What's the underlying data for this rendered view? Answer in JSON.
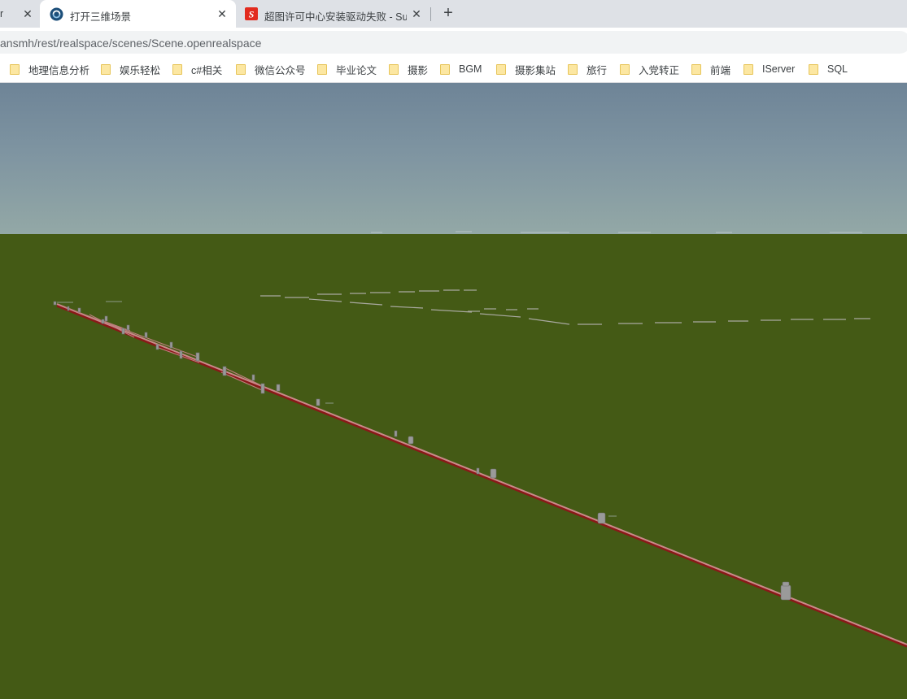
{
  "tabs": [
    {
      "title": "r",
      "active": false
    },
    {
      "title": "打开三维场景",
      "active": true
    },
    {
      "title": "超图许可中心安装驱动失败 - Sup",
      "active": false
    }
  ],
  "new_tab_label": "+",
  "address_bar": {
    "url": "ansmh/rest/realspace/scenes/Scene.openrealspace"
  },
  "bookmarks": [
    {
      "label": "地理信息分析"
    },
    {
      "label": "娱乐轻松"
    },
    {
      "label": "c#相关"
    },
    {
      "label": "微信公众号"
    },
    {
      "label": "毕业论文"
    },
    {
      "label": "摄影"
    },
    {
      "label": "BGM"
    },
    {
      "label": "摄影集站"
    },
    {
      "label": "旅行"
    },
    {
      "label": "入党转正"
    },
    {
      "label": "前端"
    },
    {
      "label": "IServer"
    },
    {
      "label": "SQL"
    }
  ],
  "scene": {
    "sky_color": "#7e94a1",
    "ground_color": "#445a15",
    "pipe_color": "#b46a6a",
    "pipe_dark_color": "#8a1818"
  }
}
